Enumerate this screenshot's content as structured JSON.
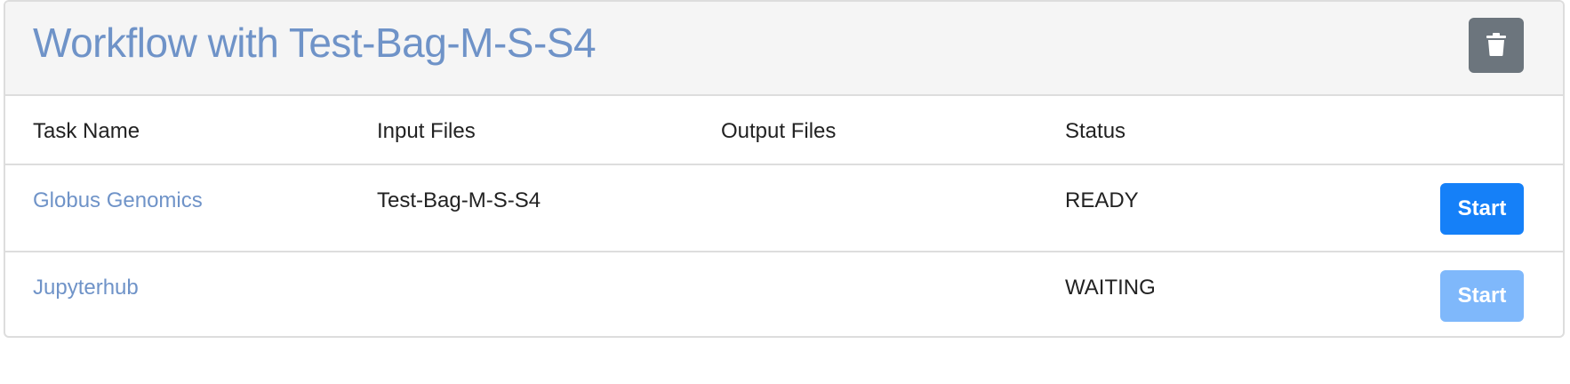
{
  "workflow": {
    "title": "Workflow with Test-Bag-M-S-S4",
    "delete_icon": "trash-icon"
  },
  "table": {
    "headers": [
      "Task Name",
      "Input Files",
      "Output Files",
      "Status"
    ],
    "rows": [
      {
        "task_name": "Globus Genomics",
        "input_files": "Test-Bag-M-S-S4",
        "output_files": "",
        "status": "READY",
        "action_label": "Start",
        "action_enabled": true
      },
      {
        "task_name": "Jupyterhub",
        "input_files": "",
        "output_files": "",
        "status": "WAITING",
        "action_label": "Start",
        "action_enabled": false
      }
    ]
  },
  "colors": {
    "title": "#6f93c8",
    "start_active": "#1580f8",
    "start_disabled": "#7fb8fb",
    "trash_button": "#6c757d"
  }
}
